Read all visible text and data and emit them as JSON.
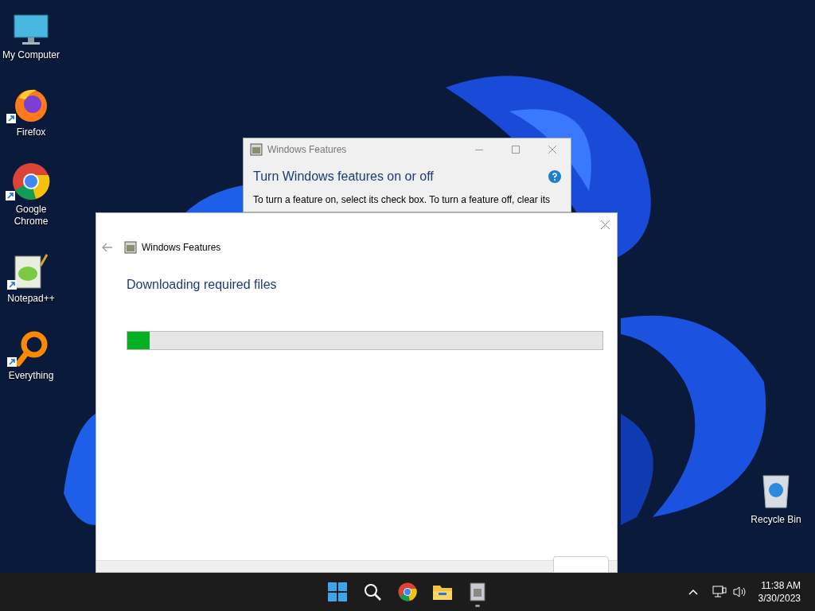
{
  "desktop_icons": [
    {
      "kind": "computer",
      "label": "My Computer"
    },
    {
      "kind": "firefox",
      "label": "Firefox"
    },
    {
      "kind": "chrome",
      "label": "Google Chrome"
    },
    {
      "kind": "notepad",
      "label": "Notepad++"
    },
    {
      "kind": "everything",
      "label": "Everything"
    }
  ],
  "recycle_bin": {
    "label": "Recycle Bin"
  },
  "back_window": {
    "title": "Windows Features",
    "heading": "Turn Windows features on or off",
    "description": "To turn a feature on, select its check box. To turn a feature off, clear its"
  },
  "dialog": {
    "title": "Windows Features",
    "heading": "Downloading required files",
    "progress": {
      "level": 0.047
    }
  },
  "taskbar": {
    "apps": [
      {
        "kind": "start"
      },
      {
        "kind": "search"
      },
      {
        "kind": "chrome"
      },
      {
        "kind": "explorer"
      },
      {
        "kind": "features",
        "running": true
      }
    ],
    "time": "11:38 AM",
    "date": "3/30/2023"
  }
}
